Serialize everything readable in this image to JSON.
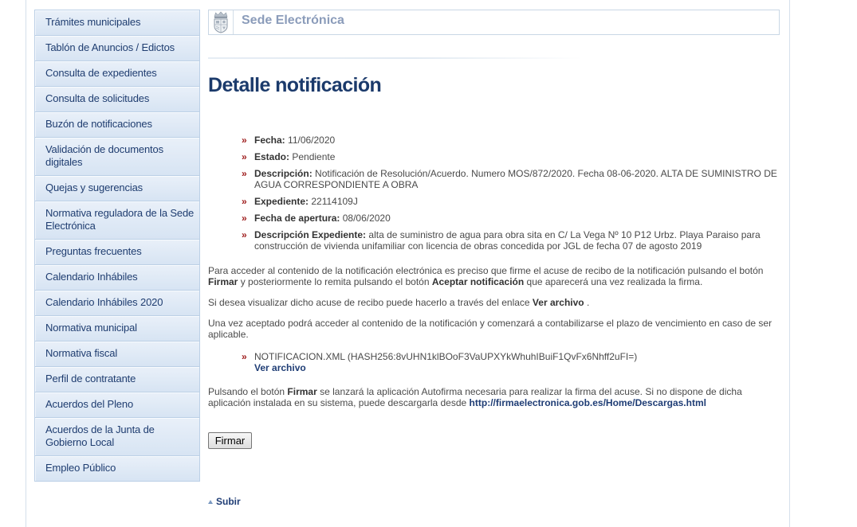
{
  "sidebar": {
    "items": [
      {
        "label": "Trámites municipales"
      },
      {
        "label": "Tablón de Anuncios / Edictos"
      },
      {
        "label": "Consulta de expedientes"
      },
      {
        "label": "Consulta de solicitudes"
      },
      {
        "label": "Buzón de notificaciones"
      },
      {
        "label": "Validación de documentos digitales"
      },
      {
        "label": "Quejas y sugerencias"
      },
      {
        "label": "Normativa reguladora de la Sede Electrónica"
      },
      {
        "label": "Preguntas frecuentes"
      },
      {
        "label": "Calendario Inhábiles"
      },
      {
        "label": "Calendario Inhábiles 2020"
      },
      {
        "label": "Normativa municipal"
      },
      {
        "label": "Normativa fiscal"
      },
      {
        "label": "Perfil de contratante"
      },
      {
        "label": "Acuerdos del Pleno"
      },
      {
        "label": "Acuerdos de la Junta de Gobierno Local"
      },
      {
        "label": "Empleo Público"
      }
    ]
  },
  "header": {
    "title": "Sede Electrónica",
    "logo_icon": "coat-of-arms-icon"
  },
  "page": {
    "title": "Detalle notificación"
  },
  "bullet_icon": "double-chevron-right-icon",
  "details": [
    {
      "label": "Fecha:",
      "value": "11/06/2020"
    },
    {
      "label": "Estado:",
      "value": "Pendiente"
    },
    {
      "label": "Descripción:",
      "value": "Notificación de Resolución/Acuerdo. Numero MOS/872/2020. Fecha 08-06-2020. ALTA DE SUMINISTRO DE AGUA CORRESPONDIENTE A OBRA"
    },
    {
      "label": "Expediente:",
      "value": "22114109J"
    },
    {
      "label": "Fecha de apertura:",
      "value": "08/06/2020"
    },
    {
      "label": "Descripción Expediente:",
      "value": "alta de suministro de agua para obra sita en C/ La Vega Nº 10 P12 Urbz. Playa Paraiso para construcción de vivienda unifamiliar con licencia de obras concedida por JGL de fecha 07 de agosto 2019"
    }
  ],
  "instructions": {
    "p1": {
      "t1": "Para acceder al contenido de la notificación electrónica es preciso que firme el acuse de recibo de la notificación pulsando el botón ",
      "b1": "Firmar",
      "t2": " y posteriormente lo remita pulsando el botón ",
      "b2": "Aceptar notificación",
      "t3": " que aparecerá una vez realizada la firma."
    },
    "p2": {
      "t1": "Si desea visualizar dicho acuse de recibo puede hacerlo a través del enlace ",
      "link": "Ver archivo",
      "t2": " ."
    },
    "p3": "Una vez aceptado podrá acceder al contenido de la notificación y comenzará a contabilizarse el plazo de vencimiento en caso de ser aplicable.",
    "p4": {
      "t1": "Pulsando el botón ",
      "b1": "Firmar",
      "t2": " se lanzará la aplicación Autofirma necesaria para realizar la firma del acuse. Si no dispone de dicha aplicación instalada en su sistema, puede descargarla desde ",
      "link": "http://firmaelectronica.gob.es/Home/Descargas.html"
    }
  },
  "attachments": [
    {
      "name": "NOTIFICACION.XML (HASH256:8vUHN1klBOoF3VaUPXYkWhuhIBuiF1QvFx6Nhff2uFI=)",
      "link": "Ver archivo"
    }
  ],
  "actions": {
    "sign_button": "Firmar"
  },
  "footer": {
    "back_to_top": "Subir",
    "back_to_top_icon": "arrow-up-icon"
  },
  "colors": {
    "title": "#1b3a6b",
    "nav_text": "#1f3d70",
    "nav_border": "#bcd0e6",
    "header_title": "#8b9cba",
    "body_text": "#4a4a4a",
    "label": "#333333",
    "link": "#1f3d75",
    "bullet": "#9e1c1c",
    "subir_arrow": "#7b9ac2",
    "frame_line": "#d5e0eb"
  }
}
